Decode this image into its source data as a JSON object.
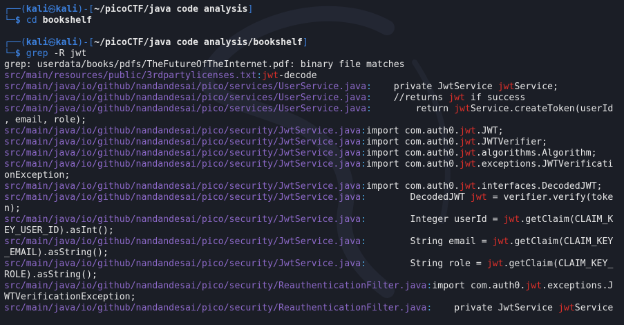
{
  "prompts": [
    {
      "user": "kali",
      "host": "kali",
      "cwd": "~/picoCTF/java code analysis",
      "command": "cd",
      "args": [
        {
          "text": "bookshelf",
          "bold": true
        }
      ]
    },
    {
      "user": "kali",
      "host": "kali",
      "cwd": "~/picoCTF/java code analysis/bookshelf",
      "command": "grep",
      "args": [
        {
          "text": "-R",
          "bold": false
        },
        {
          "text": "jwt",
          "bold": false
        }
      ]
    }
  ],
  "output": [
    [
      {
        "t": "plain",
        "v": "grep: userdata/books/pdfs/TheFutureOfTheInternet.pdf: binary file matches"
      }
    ],
    [
      {
        "t": "file",
        "v": "src/main/resources/public/3rdpartylicenses.txt"
      },
      {
        "t": "colon",
        "v": ":"
      },
      {
        "t": "match",
        "v": "jwt"
      },
      {
        "t": "plain",
        "v": "-decode"
      }
    ],
    [
      {
        "t": "file",
        "v": "src/main/java/io/github/nandandesai/pico/services/UserService.java"
      },
      {
        "t": "colon",
        "v": ":"
      },
      {
        "t": "plain",
        "v": "    private JwtService "
      },
      {
        "t": "match",
        "v": "jwt"
      },
      {
        "t": "plain",
        "v": "Service;"
      }
    ],
    [
      {
        "t": "file",
        "v": "src/main/java/io/github/nandandesai/pico/services/UserService.java"
      },
      {
        "t": "colon",
        "v": ":"
      },
      {
        "t": "plain",
        "v": "    //returns "
      },
      {
        "t": "match",
        "v": "jwt"
      },
      {
        "t": "plain",
        "v": " if success"
      }
    ],
    [
      {
        "t": "file",
        "v": "src/main/java/io/github/nandandesai/pico/services/UserService.java"
      },
      {
        "t": "colon",
        "v": ":"
      },
      {
        "t": "plain",
        "v": "        return "
      },
      {
        "t": "match",
        "v": "jwt"
      },
      {
        "t": "plain",
        "v": "Service.createToken(userId"
      }
    ],
    [
      {
        "t": "plain",
        "v": ", email, role);"
      }
    ],
    [
      {
        "t": "file",
        "v": "src/main/java/io/github/nandandesai/pico/security/JwtService.java"
      },
      {
        "t": "colon",
        "v": ":"
      },
      {
        "t": "plain",
        "v": "import com.auth0."
      },
      {
        "t": "match",
        "v": "jwt"
      },
      {
        "t": "plain",
        "v": ".JWT;"
      }
    ],
    [
      {
        "t": "file",
        "v": "src/main/java/io/github/nandandesai/pico/security/JwtService.java"
      },
      {
        "t": "colon",
        "v": ":"
      },
      {
        "t": "plain",
        "v": "import com.auth0."
      },
      {
        "t": "match",
        "v": "jwt"
      },
      {
        "t": "plain",
        "v": ".JWTVerifier;"
      }
    ],
    [
      {
        "t": "file",
        "v": "src/main/java/io/github/nandandesai/pico/security/JwtService.java"
      },
      {
        "t": "colon",
        "v": ":"
      },
      {
        "t": "plain",
        "v": "import com.auth0."
      },
      {
        "t": "match",
        "v": "jwt"
      },
      {
        "t": "plain",
        "v": ".algorithms.Algorithm;"
      }
    ],
    [
      {
        "t": "file",
        "v": "src/main/java/io/github/nandandesai/pico/security/JwtService.java"
      },
      {
        "t": "colon",
        "v": ":"
      },
      {
        "t": "plain",
        "v": "import com.auth0."
      },
      {
        "t": "match",
        "v": "jwt"
      },
      {
        "t": "plain",
        "v": ".exceptions.JWTVerificati"
      }
    ],
    [
      {
        "t": "plain",
        "v": "onException;"
      }
    ],
    [
      {
        "t": "file",
        "v": "src/main/java/io/github/nandandesai/pico/security/JwtService.java"
      },
      {
        "t": "colon",
        "v": ":"
      },
      {
        "t": "plain",
        "v": "import com.auth0."
      },
      {
        "t": "match",
        "v": "jwt"
      },
      {
        "t": "plain",
        "v": ".interfaces.DecodedJWT;"
      }
    ],
    [
      {
        "t": "file",
        "v": "src/main/java/io/github/nandandesai/pico/security/JwtService.java"
      },
      {
        "t": "colon",
        "v": ":"
      },
      {
        "t": "plain",
        "v": "        DecodedJWT "
      },
      {
        "t": "match",
        "v": "jwt"
      },
      {
        "t": "plain",
        "v": " = verifier.verify(toke"
      }
    ],
    [
      {
        "t": "plain",
        "v": "n);"
      }
    ],
    [
      {
        "t": "file",
        "v": "src/main/java/io/github/nandandesai/pico/security/JwtService.java"
      },
      {
        "t": "colon",
        "v": ":"
      },
      {
        "t": "plain",
        "v": "        Integer userId = "
      },
      {
        "t": "match",
        "v": "jwt"
      },
      {
        "t": "plain",
        "v": ".getClaim(CLAIM_K"
      }
    ],
    [
      {
        "t": "plain",
        "v": "EY_USER_ID).asInt();"
      }
    ],
    [
      {
        "t": "file",
        "v": "src/main/java/io/github/nandandesai/pico/security/JwtService.java"
      },
      {
        "t": "colon",
        "v": ":"
      },
      {
        "t": "plain",
        "v": "        String email = "
      },
      {
        "t": "match",
        "v": "jwt"
      },
      {
        "t": "plain",
        "v": ".getClaim(CLAIM_KEY"
      }
    ],
    [
      {
        "t": "plain",
        "v": "_EMAIL).asString();"
      }
    ],
    [
      {
        "t": "file",
        "v": "src/main/java/io/github/nandandesai/pico/security/JwtService.java"
      },
      {
        "t": "colon",
        "v": ":"
      },
      {
        "t": "plain",
        "v": "        String role = "
      },
      {
        "t": "match",
        "v": "jwt"
      },
      {
        "t": "plain",
        "v": ".getClaim(CLAIM_KEY_"
      }
    ],
    [
      {
        "t": "plain",
        "v": "ROLE).asString();"
      }
    ],
    [
      {
        "t": "file",
        "v": "src/main/java/io/github/nandandesai/pico/security/ReauthenticationFilter.java"
      },
      {
        "t": "colon",
        "v": ":"
      },
      {
        "t": "plain",
        "v": "import com.auth0."
      },
      {
        "t": "match",
        "v": "jwt"
      },
      {
        "t": "plain",
        "v": ".exceptions.J"
      }
    ],
    [
      {
        "t": "plain",
        "v": "WTVerificationException;"
      }
    ],
    [
      {
        "t": "file",
        "v": "src/main/java/io/github/nandandesai/pico/security/ReauthenticationFilter.java"
      },
      {
        "t": "colon",
        "v": ":"
      },
      {
        "t": "plain",
        "v": "    private JwtService "
      },
      {
        "t": "match",
        "v": "jwt"
      },
      {
        "t": "plain",
        "v": "Service"
      }
    ]
  ],
  "colors": {
    "background": "#1b1e26",
    "prompt": "#3b7ed9",
    "filename": "#8d69c9",
    "separator": "#4aa3d8",
    "match": "#e0302a",
    "text": "#e6e6e6"
  },
  "icons": {
    "user_host_separator": "kali-skull-icon",
    "watermark": "kali-dragon-watermark"
  }
}
